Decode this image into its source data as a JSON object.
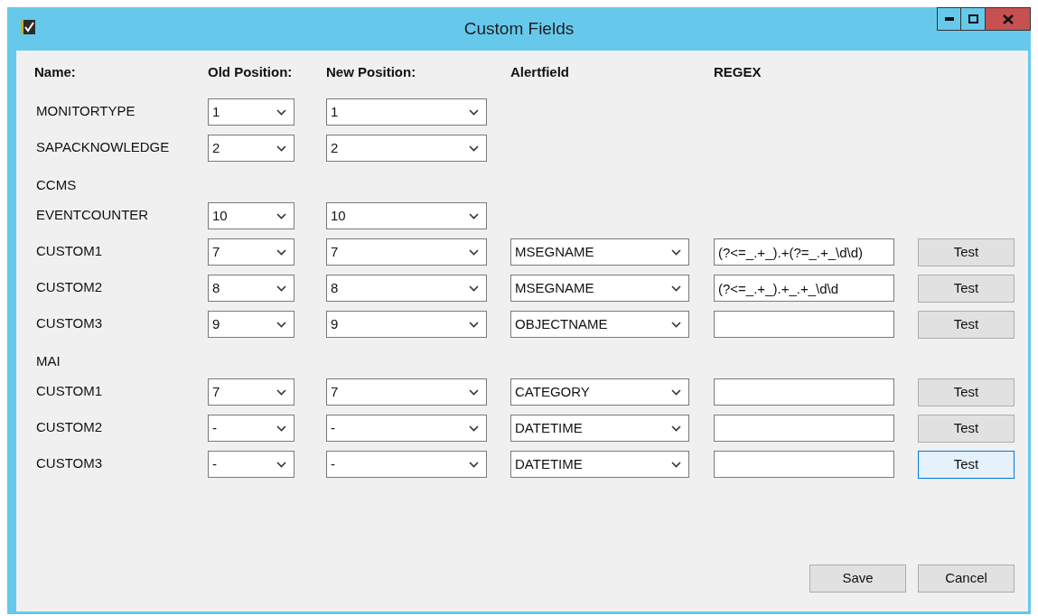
{
  "window": {
    "title": "Custom Fields"
  },
  "columns": [
    "Name:",
    "Old Position:",
    "New Position:",
    "Alertfield",
    "REGEX"
  ],
  "rows": [
    {
      "kind": "field",
      "name": "MONITORTYPE",
      "old": "1",
      "new": "1"
    },
    {
      "kind": "field",
      "name": "SAPACKNOWLEDGE",
      "old": "2",
      "new": "2"
    },
    {
      "kind": "section",
      "name": "CCMS"
    },
    {
      "kind": "field",
      "name": "EVENTCOUNTER",
      "old": "10",
      "new": "10"
    },
    {
      "kind": "field",
      "name": "CUSTOM1",
      "old": "7",
      "new": "7",
      "alertfield": "MSEGNAME",
      "regex": "(?<=_.+_).+(?=_.+_\\d\\d)",
      "test": {
        "label": "Test",
        "focused": false
      }
    },
    {
      "kind": "field",
      "name": "CUSTOM2",
      "old": "8",
      "new": "8",
      "alertfield": "MSEGNAME",
      "regex": "(?<=_.+_).+_.+_\\d\\d",
      "test": {
        "label": "Test",
        "focused": false
      }
    },
    {
      "kind": "field",
      "name": "CUSTOM3",
      "old": "9",
      "new": "9",
      "alertfield": "OBJECTNAME",
      "test": {
        "label": "Test",
        "focused": false
      }
    },
    {
      "kind": "section",
      "name": "MAI"
    },
    {
      "kind": "field",
      "name": "CUSTOM1",
      "old": "7",
      "new": "7",
      "alertfield": "CATEGORY",
      "test": {
        "label": "Test",
        "focused": false
      }
    },
    {
      "kind": "field",
      "name": "CUSTOM2",
      "old": "-",
      "new": "-",
      "alertfield": "DATETIME",
      "test": {
        "label": "Test",
        "focused": false
      }
    },
    {
      "kind": "field",
      "name": "CUSTOM3",
      "old": "-",
      "new": "-",
      "alertfield": "DATETIME",
      "test": {
        "label": "Test",
        "focused": true
      }
    }
  ],
  "buttons": [
    "Save",
    "Cancel"
  ]
}
